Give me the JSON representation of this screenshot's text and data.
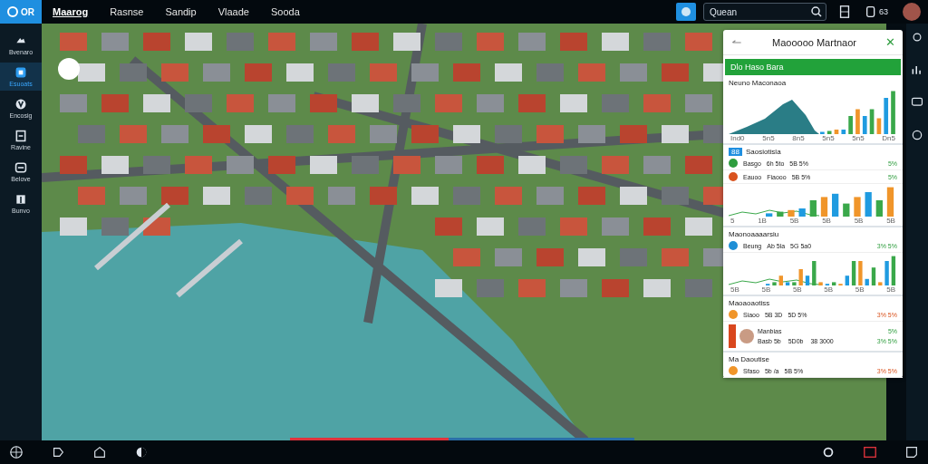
{
  "topbar": {
    "logo_text": "OR",
    "nav": [
      {
        "label": "Maarog",
        "selected": true
      },
      {
        "label": "Rasnse",
        "selected": false
      },
      {
        "label": "Sandip",
        "selected": false
      },
      {
        "label": "Vlaade",
        "selected": false
      },
      {
        "label": "Sooda",
        "selected": false
      }
    ],
    "search": {
      "placeholder": "Quean"
    },
    "status_text": "63"
  },
  "sidebar": {
    "items": [
      {
        "label": "Bvenaro",
        "selected": false
      },
      {
        "label": "Esuoats",
        "selected": true
      },
      {
        "label": "Encosig",
        "selected": false
      },
      {
        "label": "Ravine",
        "selected": false
      },
      {
        "label": "Belove",
        "selected": false
      },
      {
        "label": "Bunvo",
        "selected": false
      }
    ]
  },
  "timeline": {
    "level": 0.46
  },
  "panel": {
    "title": "Maooooo Martnaor",
    "close_label": "✕",
    "banner": "Dlo Haso Bara",
    "chart_title": "Neuno Maconaoa",
    "chart_labels": [
      "Ind0",
      "5n5",
      "8n5",
      "5n5",
      "5n5",
      "Dn5"
    ],
    "sections": [
      {
        "title": "Saosiotisla",
        "badge": "88",
        "rows": [
          {
            "color": "#2e9d3e",
            "name": "Basgo",
            "value_1": "6h 5to",
            "value_2": "5B 5%",
            "change": "5%",
            "positive": true
          },
          {
            "color": "#d9531e",
            "name": "Eauoo",
            "value_1": "Fiaooo",
            "value_2": "5B 5%",
            "change": "5%",
            "positive": true
          }
        ],
        "chart_labels": [
          "5",
          "1B",
          "5B",
          "5B",
          "5B",
          "5B"
        ]
      },
      {
        "title": "Maonoaaaarsiu",
        "rows": [
          {
            "color": "#1f8fd6",
            "name": "Beung",
            "value_1": "Ab 5la",
            "value_2": "5G 5a0",
            "change": "3% 5%",
            "positive": true
          }
        ],
        "chart_labels": [
          "5B",
          "5B",
          "5B",
          "5B",
          "5B",
          "5B"
        ]
      },
      {
        "title": "Maoaoaotiss",
        "rows": [
          {
            "color": "#f0952a",
            "name": "Siaoo",
            "value_1": "5B 3D",
            "value_2": "5D 5%",
            "change": "3% 5%",
            "positive": false
          }
        ],
        "person": {
          "name": "Manbias",
          "change": "5%",
          "value_1": "Basb 5b",
          "value_2": "5D0b",
          "value_3": "38 3000",
          "change_2": "3% 5%"
        }
      },
      {
        "title": "Ma Daoutise",
        "rows": [
          {
            "color": "#f0952a",
            "name": "Sfaso",
            "value_1": "5b /a",
            "value_2": "5B 5%",
            "change": "3% 5%",
            "positive": false
          }
        ]
      }
    ]
  }
}
